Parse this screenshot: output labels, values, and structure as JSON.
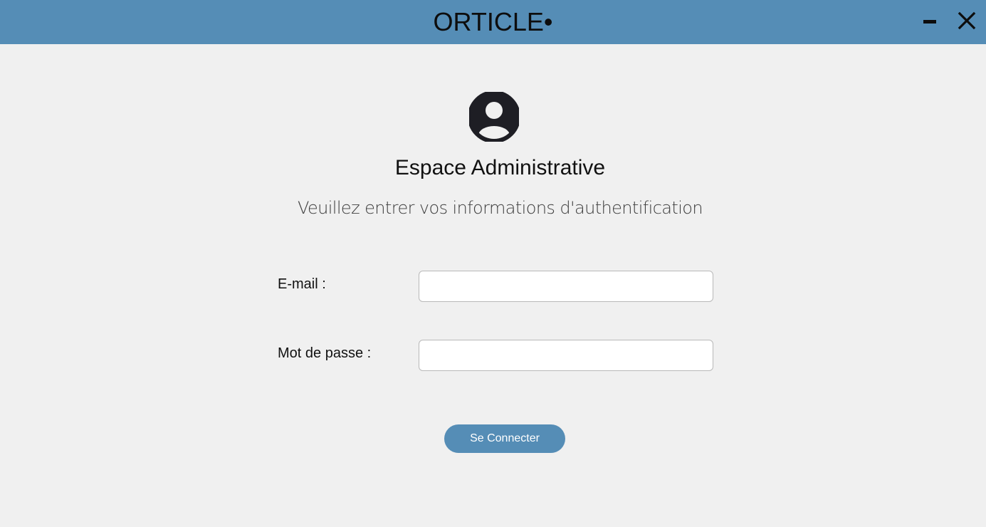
{
  "window": {
    "title": "ORTICLE•",
    "minimize_icon": "minimize-icon",
    "close_icon": "close-icon"
  },
  "colors": {
    "accent": "#558db6",
    "background": "#f0f0f0",
    "text_dark": "#111111"
  },
  "login": {
    "avatar_icon": "user-circle-icon",
    "heading": "Espace Administrative",
    "subheading": "Veuillez entrer vos informations d'authentification",
    "email_label": "E-mail :",
    "email_value": "",
    "password_label": "Mot de passe :",
    "password_value": "",
    "submit_label": "Se Connecter"
  }
}
